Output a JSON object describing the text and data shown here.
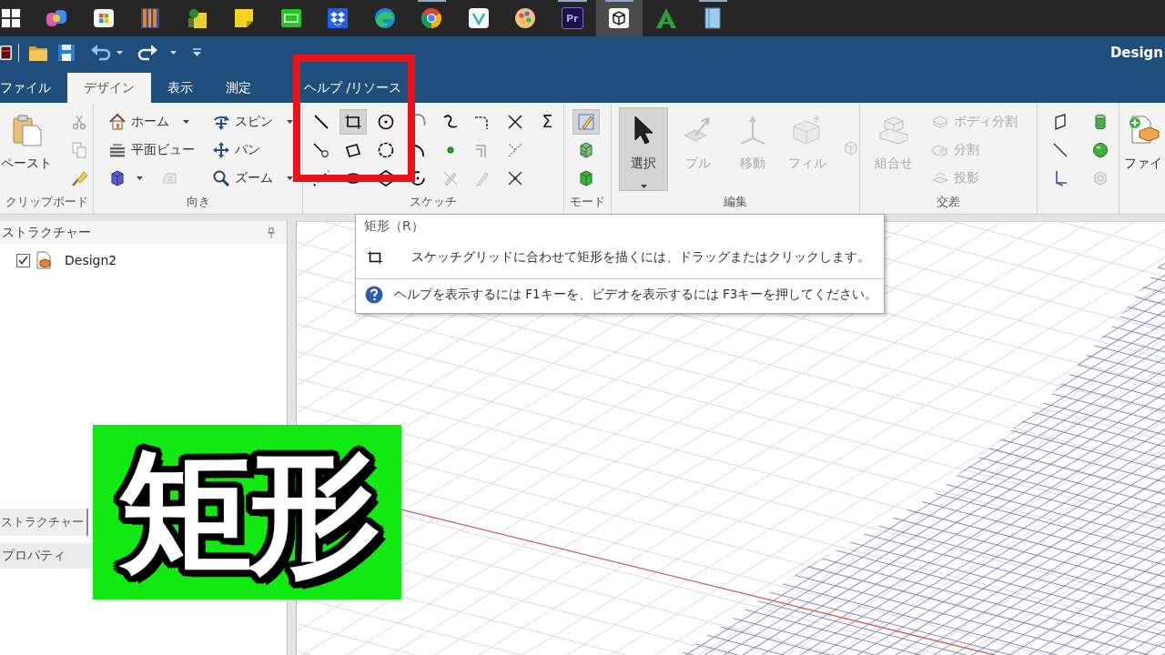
{
  "taskbar": {
    "apps": [
      {
        "selected": false,
        "running": false
      },
      {
        "selected": false,
        "running": false
      },
      {
        "selected": false,
        "running": false
      },
      {
        "selected": false,
        "running": false
      },
      {
        "selected": false,
        "running": false
      },
      {
        "selected": false,
        "running": false
      },
      {
        "selected": false,
        "running": false
      },
      {
        "selected": false,
        "running": false
      },
      {
        "selected": false,
        "running": false
      },
      {
        "selected": false,
        "running": true
      },
      {
        "selected": false,
        "running": false
      },
      {
        "selected": false,
        "running": false
      },
      {
        "label": "Pr",
        "selected": false,
        "running": true
      },
      {
        "selected": true,
        "running": true
      },
      {
        "selected": false,
        "running": false
      },
      {
        "selected": false,
        "running": true
      }
    ]
  },
  "window": {
    "title": "Design"
  },
  "ribbon_tabs": [
    {
      "label": "ファイル",
      "selected": false
    },
    {
      "label": "デザイン",
      "selected": true
    },
    {
      "label": "表示",
      "selected": false
    },
    {
      "label": "測定",
      "selected": false
    },
    {
      "label": "ヘルプ /リソース",
      "selected": false
    }
  ],
  "ribbon_groups": [
    {
      "label": "クリップボード",
      "columns": [
        [
          {
            "kind": "large",
            "label": "ペースト",
            "selected": false,
            "disabled": false,
            "dropdown": false
          }
        ],
        [
          {
            "kind": "icon",
            "selected": false,
            "disabled": true,
            "dropdown": false
          },
          {
            "kind": "icon",
            "selected": false,
            "disabled": true,
            "dropdown": false
          },
          {
            "kind": "icon",
            "selected": false,
            "disabled": false,
            "dropdown": false
          }
        ]
      ]
    },
    {
      "label": "向き",
      "columns": [
        [
          {
            "kind": "small",
            "label": "ホーム",
            "selected": false,
            "disabled": false,
            "dropdown": true
          },
          {
            "kind": "small",
            "label": "平面ビュー",
            "selected": false,
            "disabled": false,
            "dropdown": false
          },
          {
            "kind": "row",
            "items": [
              {
                "kind": "icon",
                "selected": false,
                "disabled": false,
                "dropdown": true
              },
              {
                "kind": "icon",
                "selected": false,
                "disabled": true,
                "dropdown": false
              }
            ]
          }
        ],
        [
          {
            "kind": "small",
            "label": "スピン",
            "selected": false,
            "disabled": false,
            "dropdown": true
          },
          {
            "kind": "small",
            "label": "パン",
            "selected": false,
            "disabled": false,
            "dropdown": false
          },
          {
            "kind": "small",
            "label": "ズーム",
            "selected": false,
            "disabled": false,
            "dropdown": true
          }
        ]
      ]
    },
    {
      "label": "スケッチ",
      "columns": [
        [
          {
            "kind": "icon",
            "selected": false,
            "disabled": false,
            "dropdown": false
          },
          {
            "kind": "icon",
            "selected": false,
            "disabled": false,
            "dropdown": false
          },
          {
            "kind": "icon",
            "selected": false,
            "disabled": false,
            "dropdown": false
          }
        ],
        [
          {
            "kind": "icon",
            "selected": true,
            "disabled": false,
            "dropdown": false
          },
          {
            "kind": "icon",
            "selected": false,
            "disabled": false,
            "dropdown": false
          },
          {
            "kind": "icon",
            "selected": false,
            "disabled": false,
            "dropdown": false
          }
        ],
        [
          {
            "kind": "icon",
            "selected": false,
            "disabled": false,
            "dropdown": false
          },
          {
            "kind": "icon",
            "selected": false,
            "disabled": false,
            "dropdown": false
          },
          {
            "kind": "icon",
            "selected": false,
            "disabled": false,
            "dropdown": false
          }
        ],
        [
          {
            "kind": "icon",
            "selected": false,
            "disabled": true,
            "dropdown": false
          },
          {
            "kind": "icon",
            "selected": false,
            "disabled": false,
            "dropdown": false
          },
          {
            "kind": "icon",
            "selected": false,
            "disabled": false,
            "dropdown": false
          }
        ],
        [
          {
            "kind": "icon",
            "selected": false,
            "disabled": false,
            "dropdown": false
          },
          {
            "kind": "icon",
            "selected": false,
            "disabled": false,
            "dropdown": false
          },
          {
            "kind": "icon",
            "selected": false,
            "disabled": true,
            "dropdown": false
          }
        ],
        [
          {
            "kind": "icon",
            "selected": false,
            "disabled": false,
            "dropdown": false
          },
          {
            "kind": "icon",
            "selected": false,
            "disabled": true,
            "dropdown": false
          },
          {
            "kind": "icon",
            "selected": false,
            "disabled": true,
            "dropdown": false
          }
        ],
        [
          {
            "kind": "icon",
            "selected": false,
            "disabled": false,
            "dropdown": false
          },
          {
            "kind": "icon",
            "selected": false,
            "disabled": true,
            "dropdown": false
          },
          {
            "kind": "icon",
            "selected": false,
            "disabled": false,
            "dropdown": false
          }
        ],
        [
          {
            "kind": "icon",
            "glyph": "Σ",
            "selected": false,
            "disabled": false,
            "dropdown": false
          }
        ]
      ]
    },
    {
      "label": "モード",
      "columns": [
        [
          {
            "kind": "icon",
            "selected": true,
            "disabled": false,
            "dropdown": false
          },
          {
            "kind": "icon",
            "selected": false,
            "disabled": false,
            "dropdown": false
          },
          {
            "kind": "icon",
            "selected": false,
            "disabled": false,
            "dropdown": false
          }
        ]
      ]
    },
    {
      "label": "編集",
      "columns": [
        [
          {
            "kind": "large",
            "label": "選択",
            "selected": true,
            "disabled": false,
            "dropdown": true
          }
        ],
        [
          {
            "kind": "large",
            "label": "プル",
            "selected": false,
            "disabled": true,
            "dropdown": false
          }
        ],
        [
          {
            "kind": "large",
            "label": "移動",
            "selected": false,
            "disabled": true,
            "dropdown": false
          }
        ],
        [
          {
            "kind": "large",
            "label": "フィル",
            "selected": false,
            "disabled": true,
            "dropdown": false
          }
        ],
        [
          {
            "kind": "icon",
            "selected": false,
            "disabled": true,
            "dropdown": false
          }
        ]
      ]
    },
    {
      "label": "交差",
      "columns": [
        [
          {
            "kind": "large",
            "label": "組合せ",
            "selected": false,
            "disabled": true,
            "dropdown": false
          }
        ],
        [
          {
            "kind": "small",
            "label": "ボディ分割",
            "selected": false,
            "disabled": true,
            "dropdown": false
          },
          {
            "kind": "small",
            "label": "分割",
            "selected": false,
            "disabled": true,
            "dropdown": false
          },
          {
            "kind": "small",
            "label": "投影",
            "selected": false,
            "disabled": true,
            "dropdown": false
          }
        ]
      ]
    },
    {
      "columns": [
        [
          {
            "kind": "icon",
            "selected": false,
            "disabled": false,
            "dropdown": false
          },
          {
            "kind": "icon",
            "selected": false,
            "disabled": false,
            "dropdown": false
          },
          {
            "kind": "icon",
            "selected": false,
            "disabled": false,
            "dropdown": false
          }
        ],
        [
          {
            "kind": "icon",
            "selected": false,
            "disabled": false,
            "dropdown": false
          },
          {
            "kind": "icon",
            "selected": false,
            "disabled": false,
            "dropdown": false
          },
          {
            "kind": "icon",
            "selected": false,
            "disabled": true,
            "dropdown": false
          }
        ]
      ]
    },
    {
      "columns": [
        [
          {
            "kind": "large",
            "label": "ファイ",
            "selected": false,
            "disabled": false,
            "dropdown": false
          }
        ]
      ]
    }
  ],
  "structure_panel": {
    "title": "ストラクチャー",
    "tree": [
      {
        "label": "Design2",
        "checked": true
      }
    ]
  },
  "panel_tabs": [
    {
      "label": "ストラクチャー",
      "selected": true
    }
  ],
  "properties_panel": {
    "title": "プロパティ"
  },
  "tooltip": {
    "title": "矩形（R）",
    "description": "スケッチグリッドに合わせて矩形を描くには、ドラッグまたはクリックします。",
    "help": "ヘルプを表示するには F1キーを、ビデオを表示するには F3キーを押してください。"
  },
  "caption": {
    "text": "矩形"
  }
}
